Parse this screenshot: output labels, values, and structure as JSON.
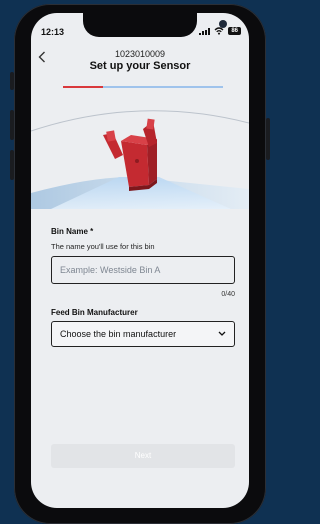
{
  "status_bar": {
    "time": "12:13",
    "battery": "86"
  },
  "header": {
    "serial": "1023010009",
    "title": "Set up your Sensor",
    "back_icon": "chevron-left-icon"
  },
  "progress": {
    "value": 0.25,
    "fill_color": "#d9383c",
    "track_color": "#9fc3ec"
  },
  "form": {
    "bin_name": {
      "label": "Bin Name *",
      "hint": "The name you'll use for this bin",
      "placeholder": "Example: Westside Bin A",
      "counter": "0/40"
    },
    "manufacturer": {
      "label": "Feed Bin Manufacturer",
      "selected": "Choose the bin manufacturer",
      "icon": "chevron-down-icon"
    }
  },
  "footer": {
    "next_label": "Next"
  }
}
